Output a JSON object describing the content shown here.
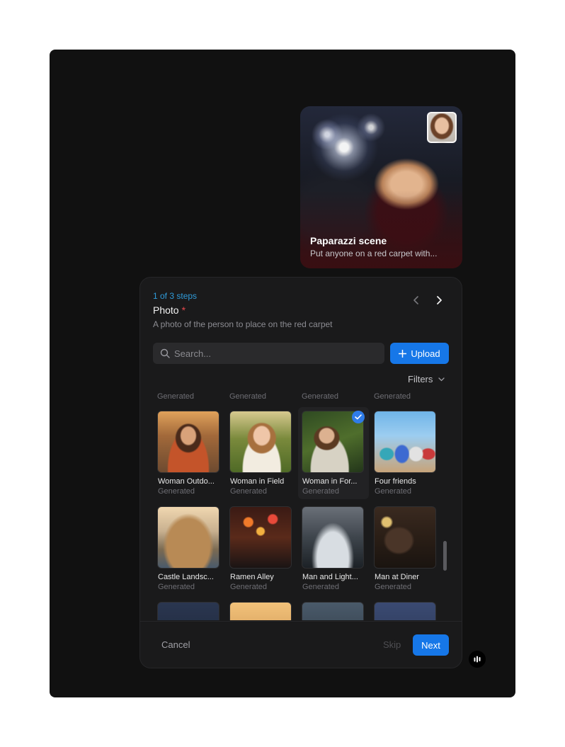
{
  "preview": {
    "title": "Paparazzi scene",
    "description": "Put anyone on a red carpet with..."
  },
  "step": {
    "indicator": "1 of 3 steps",
    "field_title": "Photo",
    "required_marker": "*",
    "description": "A photo of the person to place on the red carpet"
  },
  "search": {
    "placeholder": "Search...",
    "value": ""
  },
  "upload_label": "Upload",
  "filters_label": "Filters",
  "column_headers": [
    "Generated",
    "Generated",
    "Generated",
    "Generated"
  ],
  "tiles": [
    {
      "name": "Woman Outdo...",
      "type": "Generated",
      "selected": false
    },
    {
      "name": "Woman in Field",
      "type": "Generated",
      "selected": false
    },
    {
      "name": "Woman in For...",
      "type": "Generated",
      "selected": true
    },
    {
      "name": "Four friends",
      "type": "Generated",
      "selected": false
    },
    {
      "name": "Castle Landsc...",
      "type": "Generated",
      "selected": false
    },
    {
      "name": "Ramen Alley",
      "type": "Generated",
      "selected": false
    },
    {
      "name": "Man and Light...",
      "type": "Generated",
      "selected": false
    },
    {
      "name": "Man at Diner",
      "type": "Generated",
      "selected": false
    }
  ],
  "footer": {
    "cancel_label": "Cancel",
    "skip_label": "Skip",
    "next_label": "Next"
  },
  "colors": {
    "accent": "#1677e8",
    "step_indicator": "#2f9bd9",
    "required": "#e5484d",
    "background": "#111111",
    "panel": "#1a1a1b"
  },
  "icons": [
    "chevron-left-icon",
    "chevron-right-icon",
    "search-icon",
    "plus-icon",
    "chevron-down-icon",
    "check-icon",
    "assistant-icon"
  ]
}
